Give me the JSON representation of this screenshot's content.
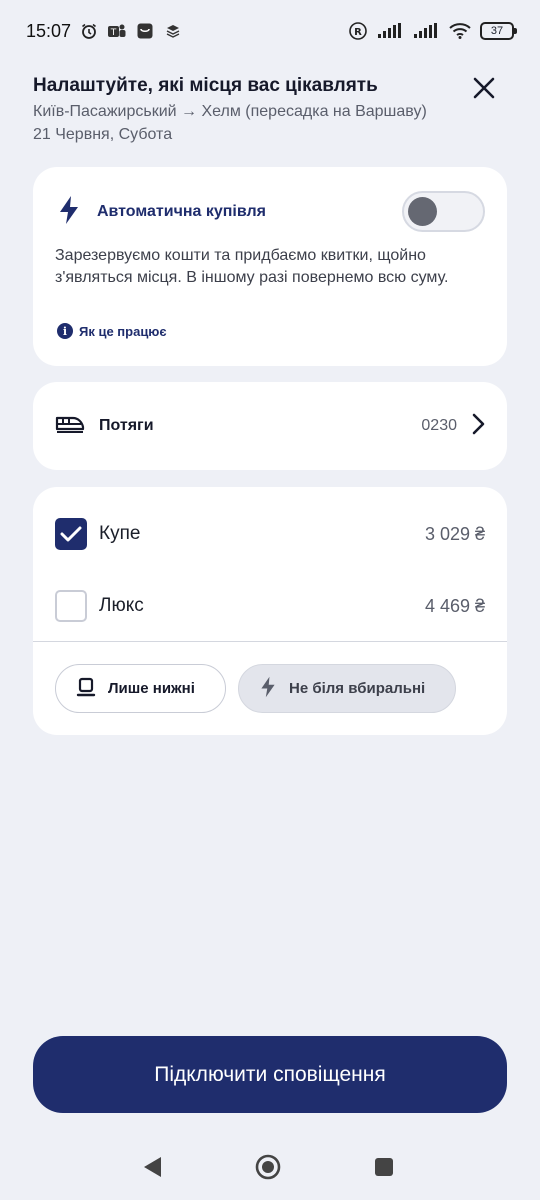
{
  "status_bar": {
    "time": "15:07",
    "battery": "37"
  },
  "header": {
    "title": "Налаштуйте, які місця вас цікавлять",
    "route": "Київ-Пасажирський → Хелм (пересадка на Варшаву)",
    "date": "21 Червня, Субота"
  },
  "auto_purchase": {
    "title": "Автоматична купівля",
    "enabled": false,
    "description": "Зарезервуємо кошти та придбаємо квитки, щойно з'являться місця. В іншому разі повернемо всю суму.",
    "how_link": "Як це працює"
  },
  "trains": {
    "label": "Потяги",
    "value": "0230"
  },
  "seats": {
    "options": [
      {
        "name": "Купе",
        "price": "3 029 ₴",
        "checked": true
      },
      {
        "name": "Люкс",
        "price": "4 469 ₴",
        "checked": false
      }
    ],
    "filters": {
      "lower_only": "Лише нижні",
      "not_near_wc": "Не біля вбиральні"
    }
  },
  "actions": {
    "subscribe": "Підключити сповіщення"
  },
  "colors": {
    "accent": "#1f2d6d",
    "background": "#eef0f6"
  }
}
